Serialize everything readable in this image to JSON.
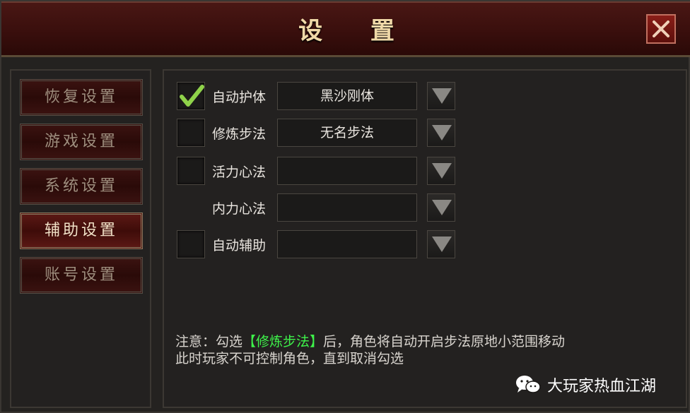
{
  "window": {
    "title": "设 置"
  },
  "sidebar": {
    "items": [
      {
        "label": "恢复设置",
        "active": false
      },
      {
        "label": "游戏设置",
        "active": false
      },
      {
        "label": "系统设置",
        "active": false
      },
      {
        "label": "辅助设置",
        "active": true
      },
      {
        "label": "账号设置",
        "active": false
      }
    ]
  },
  "options": [
    {
      "label": "自动护体",
      "checked": true,
      "has_checkbox": true,
      "value": "黑沙刚体"
    },
    {
      "label": "修炼步法",
      "checked": false,
      "has_checkbox": true,
      "value": "无名步法"
    },
    {
      "label": "活力心法",
      "checked": false,
      "has_checkbox": true,
      "value": ""
    },
    {
      "label": "内力心法",
      "checked": false,
      "has_checkbox": false,
      "value": ""
    },
    {
      "label": "自动辅助",
      "checked": false,
      "has_checkbox": true,
      "value": ""
    }
  ],
  "notice": {
    "prefix": "注意：勾选",
    "highlight": "【修炼步法】",
    "suffix": "后，角色将自动开启步法原地小范围移动",
    "line2": "此时玩家不可控制角色，直到取消勾选"
  },
  "watermark": {
    "text": "大玩家热血江湖",
    "icon": "wechat-icon"
  },
  "colors": {
    "highlight": "#3ef24a",
    "title": "#f0d9a8",
    "titlebar": "#3a0f0d"
  }
}
